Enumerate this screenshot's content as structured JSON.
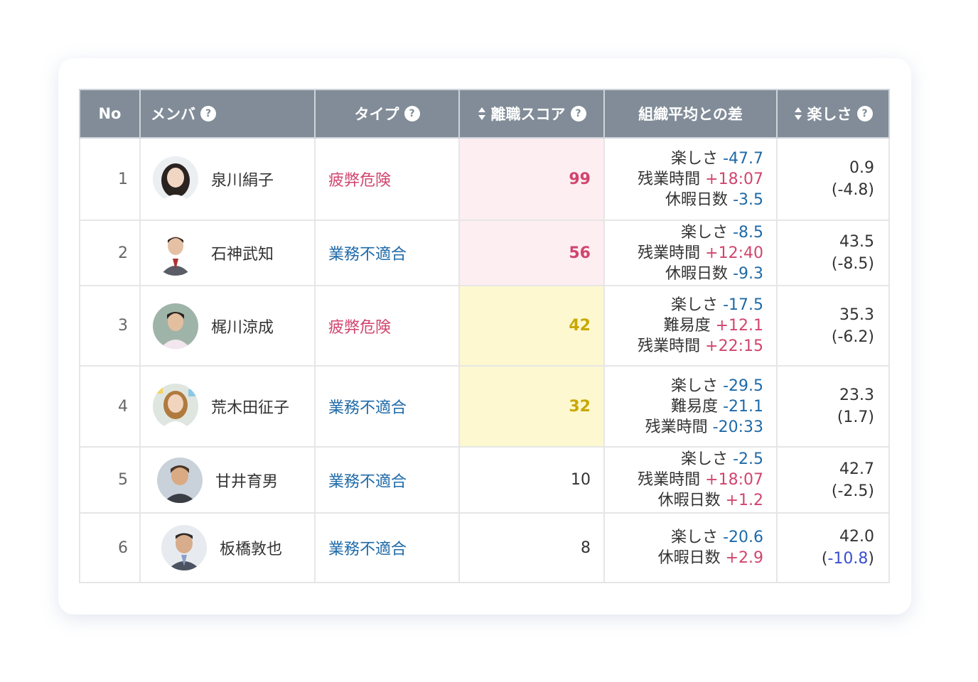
{
  "headers": {
    "no": "No",
    "member": "メンバ",
    "type": "タイプ",
    "score": "離職スコア",
    "diff": "組織平均との差",
    "fun": "楽しさ",
    "help_glyph": "?"
  },
  "rows": [
    {
      "no": "1",
      "name": "泉川絹子",
      "type": "疲弊危険",
      "type_kind": "fatigue",
      "score": "99",
      "score_level": "high",
      "diff": [
        {
          "label": "楽しさ",
          "value": "-47.7",
          "sign": "neg"
        },
        {
          "label": "残業時間",
          "value": "+18:07",
          "sign": "pos"
        },
        {
          "label": "休暇日数",
          "value": "-3.5",
          "sign": "neg"
        }
      ],
      "fun": "0.9",
      "fun_delta": "(-4.8)",
      "avatar_icon": "woman-portrait-icon"
    },
    {
      "no": "2",
      "name": "石神武知",
      "type": "業務不適合",
      "type_kind": "mismatch",
      "score": "56",
      "score_level": "high",
      "diff": [
        {
          "label": "楽しさ",
          "value": "-8.5",
          "sign": "neg"
        },
        {
          "label": "残業時間",
          "value": "+12:40",
          "sign": "pos"
        },
        {
          "label": "休暇日数",
          "value": "-9.3",
          "sign": "neg"
        }
      ],
      "fun": "43.5",
      "fun_delta": "(-8.5)",
      "avatar_icon": "man-suit-portrait-icon"
    },
    {
      "no": "3",
      "name": "梶川涼成",
      "type": "疲弊危険",
      "type_kind": "fatigue",
      "score": "42",
      "score_level": "mid",
      "diff": [
        {
          "label": "楽しさ",
          "value": "-17.5",
          "sign": "neg"
        },
        {
          "label": "難易度",
          "value": "+12.1",
          "sign": "pos"
        },
        {
          "label": "残業時間",
          "value": "+22:15",
          "sign": "pos"
        }
      ],
      "fun": "35.3",
      "fun_delta": "(-6.2)",
      "avatar_icon": "man-casual-portrait-icon"
    },
    {
      "no": "4",
      "name": "荒木田征子",
      "type": "業務不適合",
      "type_kind": "mismatch",
      "score": "32",
      "score_level": "mid",
      "diff": [
        {
          "label": "楽しさ",
          "value": "-29.5",
          "sign": "neg"
        },
        {
          "label": "難易度",
          "value": "-21.1",
          "sign": "neg"
        },
        {
          "label": "残業時間",
          "value": "-20:33",
          "sign": "neg"
        }
      ],
      "fun": "23.3",
      "fun_delta": "(1.7)",
      "avatar_icon": "woman-office-portrait-icon"
    },
    {
      "no": "5",
      "name": "甘井育男",
      "type": "業務不適合",
      "type_kind": "mismatch",
      "score": "10",
      "score_level": "low",
      "diff": [
        {
          "label": "楽しさ",
          "value": "-2.5",
          "sign": "neg"
        },
        {
          "label": "残業時間",
          "value": "+18:07",
          "sign": "pos"
        },
        {
          "label": "休暇日数",
          "value": "+1.2",
          "sign": "pos"
        }
      ],
      "fun": "42.7",
      "fun_delta": "(-2.5)",
      "avatar_icon": "man-smiling-portrait-icon"
    },
    {
      "no": "6",
      "name": "板橋敦也",
      "type": "業務不適合",
      "type_kind": "mismatch",
      "score": "8",
      "score_level": "low",
      "diff": [
        {
          "label": "楽しさ",
          "value": "-20.6",
          "sign": "neg"
        },
        {
          "label": "休暇日数",
          "value": "+2.9",
          "sign": "pos"
        }
      ],
      "fun": "42.0",
      "fun_delta_prefix": "(",
      "fun_delta_value": "-10.8",
      "fun_delta_suffix": ")",
      "avatar_icon": "man-business-portrait-icon"
    }
  ],
  "colors": {
    "header_bg": "#818c98",
    "positive": "#d1456e",
    "negative": "#1f6aa8",
    "score_high_bg": "#fdeef2",
    "score_mid_bg": "#fdf8d0",
    "score_mid_text": "#c9a800"
  }
}
